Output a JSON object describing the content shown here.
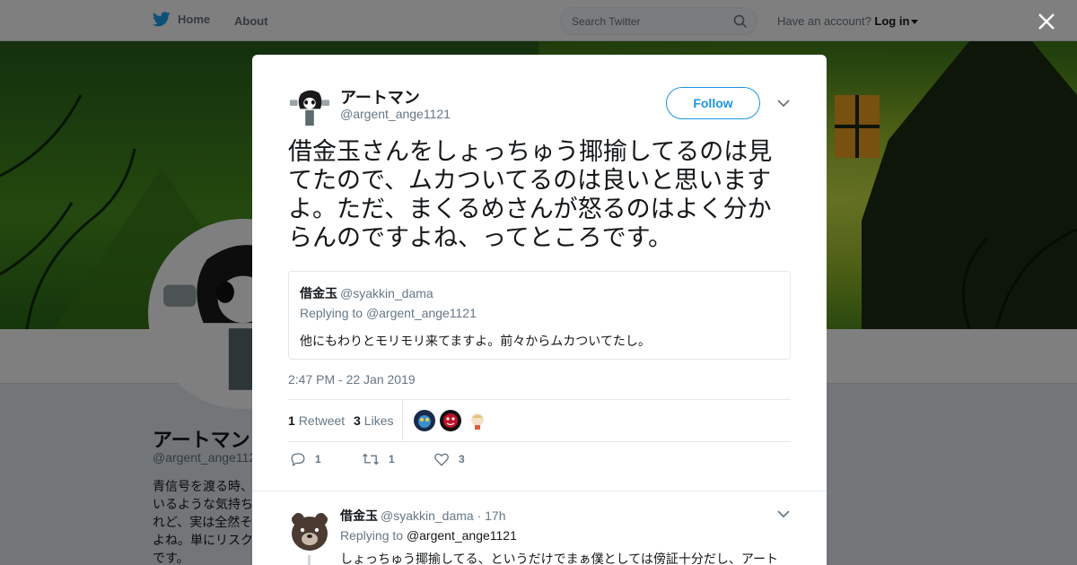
{
  "topbar": {
    "home_label": "Home",
    "about_label": "About",
    "search_placeholder": "Search Twitter",
    "account_prompt": "Have an account?",
    "login_label": "Log in"
  },
  "background_profile": {
    "name": "アートマン",
    "handle": "@argent_ange1121",
    "bio_lines": [
      "青信号を渡る時、",
      "いるような気持ち",
      "れど、実は全然そ",
      "よね。単にリスク",
      "です。"
    ]
  },
  "tweet": {
    "author_name": "アートマン",
    "author_handle": "@argent_ange1121",
    "follow_label": "Follow",
    "text": "借金玉さんをしょっちゅう揶揄してるのは見てたので、ムカついてるのは良いと思いますよ。ただ、まくるめさんが怒るのはよく分からんのですよね、ってところです。",
    "quoted": {
      "author_name": "借金玉",
      "author_handle": "@syakkin_dama",
      "replying_prefix": "Replying to",
      "replying_to": "@argent_ange1121",
      "text": "他にもわりとモリモリ来てますよ。前々からムカついてたし。"
    },
    "timestamp": "2:47 PM - 22 Jan 2019",
    "retweet_count": "1",
    "retweet_label": "Retweet",
    "like_count": "3",
    "like_label": "Likes",
    "actions": {
      "reply_count": "1",
      "retweet_count": "1",
      "like_count": "3"
    }
  },
  "reply": {
    "author_name": "借金玉",
    "author_handle": "@syakkin_dama",
    "time": "· 17h",
    "replying_prefix": "Replying to",
    "replying_to": "@argent_ange1121",
    "text": "しょっちゅう揶揄してる、というだけでまぁ僕としては傍証十分だし、アート"
  },
  "colors": {
    "accent": "#1b95e0",
    "twitter_blue": "#1da1f2",
    "muted": "#657786"
  }
}
